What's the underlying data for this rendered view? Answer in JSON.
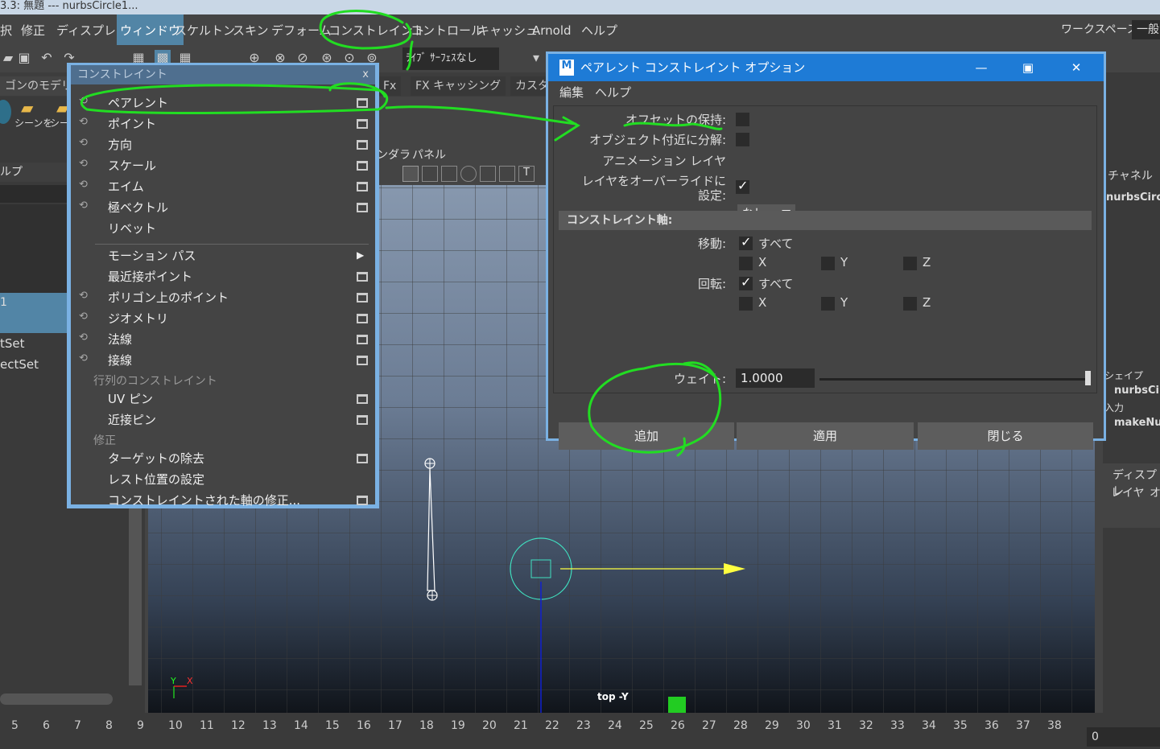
{
  "title_bar": {
    "text": "3.3: 無題   ---   nurbsCircle1..."
  },
  "menubar": {
    "items": [
      "択",
      "修正",
      "ディスプレイ",
      "ウィンドウ",
      "スケルトン",
      "スキン",
      "デフォーム",
      "コンストレイント",
      "コントロール",
      "キャッシュ",
      "Arnold",
      "ヘルプ"
    ],
    "active": "ウィンドウ",
    "workspace_label": "ワークスペース:",
    "workspace_value": "一般"
  },
  "toolbar": {
    "live_surface": "ﾗｲﾌﾞ ｻｰﾌｪｽなし"
  },
  "shelf": {
    "tabs": [
      "ゴンのモデリング",
      "Fx",
      "FX キャッシング",
      "カスタ"
    ],
    "icon_labels": [
      "シーンを",
      "シー"
    ]
  },
  "left_panel": {
    "header": "ルプ",
    "items": [
      "1",
      "tSet",
      "ectSet"
    ]
  },
  "viewport": {
    "menu": [
      "ンダラ",
      "パネル"
    ],
    "camera_label": "top -Y",
    "axis_y": "Y",
    "axis_x": "X"
  },
  "right_panel": {
    "channel": "チャネル",
    "obj": "nurbsCirc",
    "shape": "シェイプ",
    "shape_item": "nurbsCir",
    "input": "入力",
    "input_item": "makeNu",
    "disp": "ディスプレ",
    "layer": "レイヤ",
    "other": "オ"
  },
  "timeline": {
    "ticks": [
      "5",
      "6",
      "7",
      "8",
      "9",
      "10",
      "11",
      "12",
      "13",
      "14",
      "15",
      "16",
      "17",
      "18",
      "19",
      "20",
      "21",
      "22",
      "23",
      "24",
      "25",
      "26",
      "27",
      "28",
      "29",
      "30",
      "31",
      "32",
      "33",
      "34",
      "35",
      "36",
      "37",
      "38"
    ],
    "current": "0"
  },
  "constraint_menu": {
    "title": "コンストレイント",
    "close": "x",
    "items": [
      {
        "label": "ペアレント",
        "opt": true,
        "icon": "parent-constraint-icon"
      },
      {
        "label": "ポイント",
        "opt": true,
        "icon": "point-constraint-icon"
      },
      {
        "label": "方向",
        "opt": true,
        "icon": "orient-constraint-icon"
      },
      {
        "label": "スケール",
        "opt": true,
        "icon": "scale-constraint-icon"
      },
      {
        "label": "エイム",
        "opt": true,
        "icon": "aim-constraint-icon"
      },
      {
        "label": "極ベクトル",
        "opt": true,
        "icon": "pole-vector-icon"
      },
      {
        "label": "リベット",
        "opt": false,
        "icon": ""
      }
    ],
    "items2": [
      {
        "label": "モーション パス",
        "opt": false,
        "submenu": true
      },
      {
        "label": "最近接ポイント",
        "opt": true
      },
      {
        "label": "ポリゴン上のポイント",
        "opt": true
      },
      {
        "label": "ジオメトリ",
        "opt": true
      },
      {
        "label": "法線",
        "opt": true
      },
      {
        "label": "接線",
        "opt": true
      }
    ],
    "section_matrix": "行列のコンストレイント",
    "items3": [
      {
        "label": "UV ピン"
      },
      {
        "label": "近接ピン"
      }
    ],
    "section_modify": "修正",
    "items4": [
      {
        "label": "ターゲットの除去",
        "opt": true
      },
      {
        "label": "レスト位置の設定",
        "opt": false
      },
      {
        "label": "コンストレイントされた軸の修正...",
        "opt": true
      }
    ]
  },
  "dialog": {
    "title": "ペアレント コンストレイント オプション",
    "logo": "M",
    "menu": [
      "編集",
      "ヘルプ"
    ],
    "maintain_offset_label": "オフセットの保持:",
    "maintain_offset": false,
    "decompose_label": "オブジェクト付近に分解:",
    "decompose": false,
    "anim_layer_label": "アニメーション レイヤ",
    "anim_layer_value": "なし",
    "override_label_1": "レイヤをオーバーライドに",
    "override_label_2": "設定:",
    "override": true,
    "axes_header": "コンストレイント軸:",
    "translate_label": "移動:",
    "rotate_label": "回転:",
    "all_label": "すべて",
    "x": "X",
    "y": "Y",
    "z": "Z",
    "weight_label": "ウェイト:",
    "weight_value": "1.0000",
    "weight": 1.0,
    "buttons": {
      "add": "追加",
      "apply": "適用",
      "close": "閉じる"
    }
  },
  "annotation_color": "#22dd22"
}
